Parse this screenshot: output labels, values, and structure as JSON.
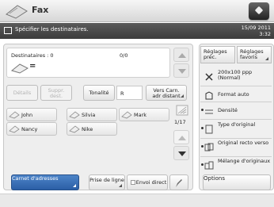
{
  "window": {
    "title": "Fax"
  },
  "status": {
    "message": "Spécifier les destinataires.",
    "date": "15/09 2011",
    "time": "3:32"
  },
  "destinations": {
    "label": "Destinataires : 0",
    "count": "0/0",
    "value": "="
  },
  "toolbar": {
    "details": "Détails",
    "delete": "Suppr. dest.",
    "tonality_label": "Tonalité",
    "tonality_value": "R",
    "remote_address_book": "Vers Carn. adr distant"
  },
  "contacts": [
    "John",
    "Silvia",
    "Mark",
    "Nancy",
    "Nike"
  ],
  "pager": {
    "page": "1/17"
  },
  "bottom": {
    "address_book": "Carnet d'adresses",
    "line": "Prise de ligne",
    "direct_send": "Envoi direct"
  },
  "right_tabs": [
    "Réglages préc.",
    "Réglages favoris"
  ],
  "settings": [
    {
      "icon": "resolution-icon",
      "label": "200x100 ppp (Normal)"
    },
    {
      "icon": "format-icon",
      "label": "Format auto"
    },
    {
      "icon": "density-icon",
      "label": "Densité"
    },
    {
      "icon": "original-type-icon",
      "label": "Type d'original"
    },
    {
      "icon": "duplex-icon",
      "label": "Original recto verso"
    },
    {
      "icon": "mixed-originals-icon",
      "label": "Mélange d'originaux"
    }
  ],
  "options": "Options",
  "colors": {
    "accent": "#2b5fa6",
    "status_bg": "#4a4a4a"
  }
}
